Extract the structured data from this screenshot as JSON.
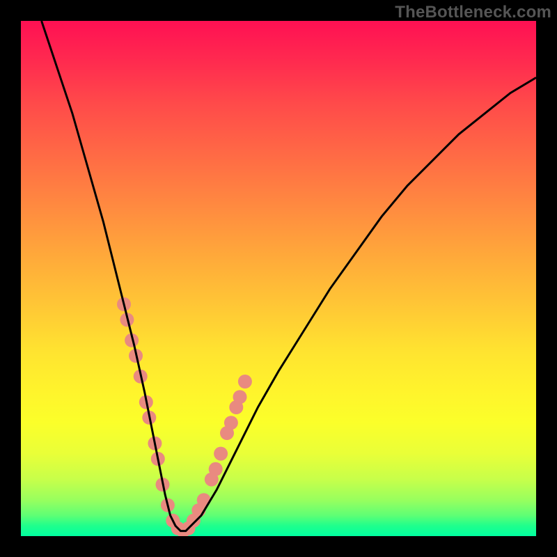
{
  "watermark": "TheBottleneck.com",
  "chart_data": {
    "type": "line",
    "title": "",
    "xlabel": "",
    "ylabel": "",
    "xlim": [
      0,
      100
    ],
    "ylim": [
      0,
      100
    ],
    "grid": false,
    "series": [
      {
        "name": "curve",
        "color": "#000000",
        "x": [
          4,
          6,
          8,
          10,
          12,
          14,
          16,
          18,
          20,
          22,
          24,
          25,
          26,
          27,
          28,
          29,
          30,
          31,
          32,
          33,
          35,
          38,
          42,
          46,
          50,
          55,
          60,
          65,
          70,
          75,
          80,
          85,
          90,
          95,
          100
        ],
        "y": [
          100,
          94,
          88,
          82,
          75,
          68,
          61,
          53,
          45,
          37,
          28,
          23,
          18,
          13,
          8,
          4,
          2,
          1,
          1,
          2,
          4,
          9,
          17,
          25,
          32,
          40,
          48,
          55,
          62,
          68,
          73,
          78,
          82,
          86,
          89
        ]
      }
    ],
    "markers": {
      "color": "#e98a80",
      "radius": 10,
      "points": [
        {
          "x": 20.0,
          "y": 45
        },
        {
          "x": 20.6,
          "y": 42
        },
        {
          "x": 21.5,
          "y": 38
        },
        {
          "x": 22.3,
          "y": 35
        },
        {
          "x": 23.2,
          "y": 31
        },
        {
          "x": 24.3,
          "y": 26
        },
        {
          "x": 24.9,
          "y": 23
        },
        {
          "x": 26.0,
          "y": 18
        },
        {
          "x": 26.6,
          "y": 15
        },
        {
          "x": 27.5,
          "y": 10
        },
        {
          "x": 28.5,
          "y": 6
        },
        {
          "x": 29.5,
          "y": 3
        },
        {
          "x": 30.5,
          "y": 1.5
        },
        {
          "x": 31.5,
          "y": 1
        },
        {
          "x": 32.5,
          "y": 1.5
        },
        {
          "x": 33.5,
          "y": 3
        },
        {
          "x": 34.5,
          "y": 5
        },
        {
          "x": 35.5,
          "y": 7
        },
        {
          "x": 37.0,
          "y": 11
        },
        {
          "x": 37.8,
          "y": 13
        },
        {
          "x": 38.8,
          "y": 16
        },
        {
          "x": 40.0,
          "y": 20
        },
        {
          "x": 40.8,
          "y": 22
        },
        {
          "x": 41.8,
          "y": 25
        },
        {
          "x": 42.5,
          "y": 27
        },
        {
          "x": 43.5,
          "y": 30
        }
      ]
    },
    "background_gradient": {
      "top": "#ff1053",
      "bottom": "#00ffa0"
    }
  }
}
